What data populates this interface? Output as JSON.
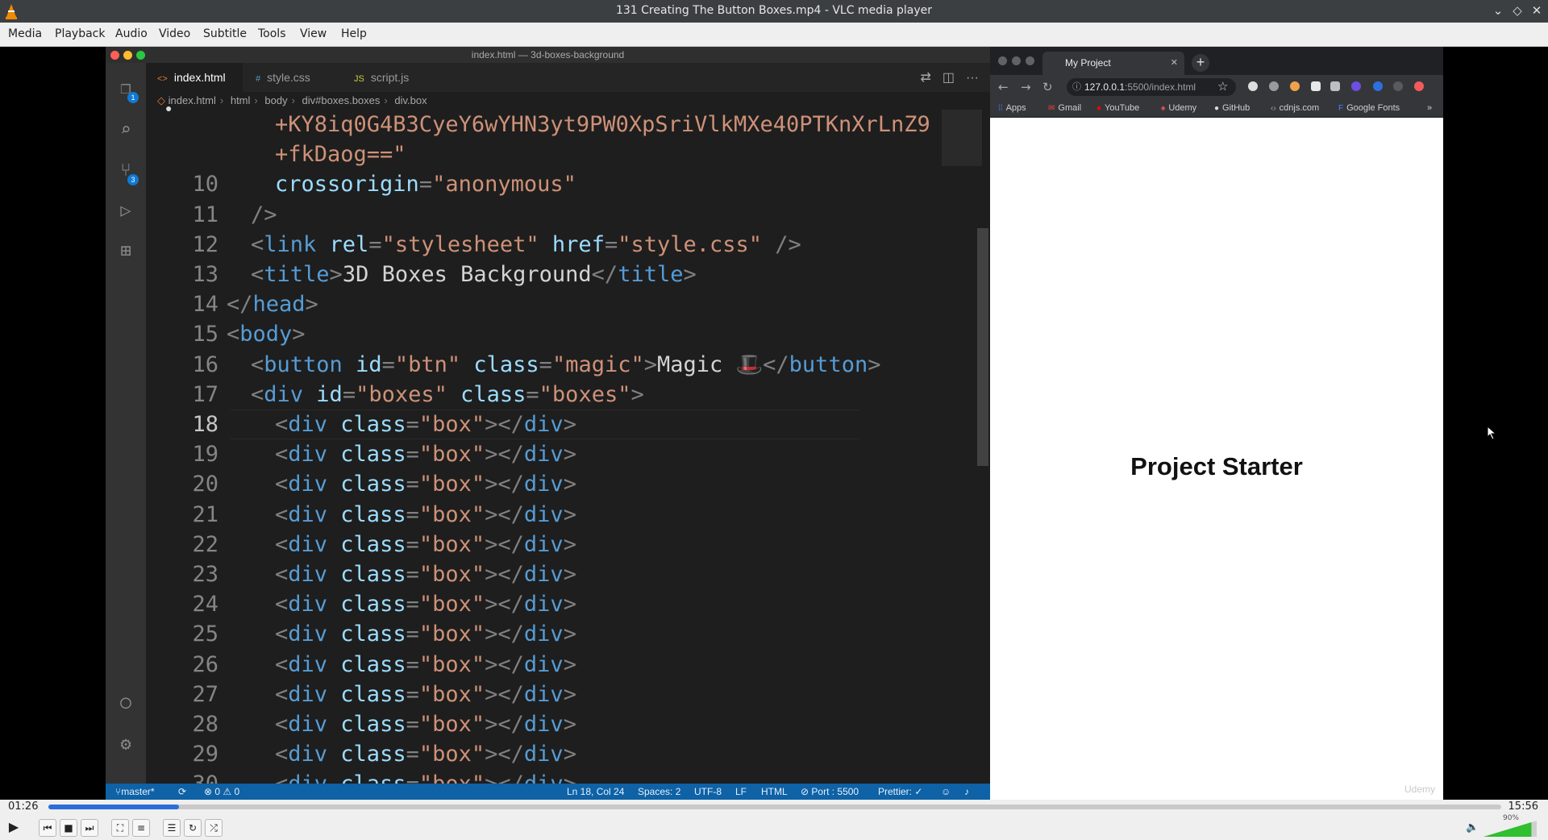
{
  "window": {
    "title": "131 Creating The Button Boxes.mp4 - VLC media player"
  },
  "menubar": [
    "Media",
    "Playback",
    "Audio",
    "Video",
    "Subtitle",
    "Tools",
    "View",
    "Help"
  ],
  "editor": {
    "window_title": "index.html — 3d-boxes-background",
    "tabs": [
      {
        "label": "index.html",
        "icon": "<>",
        "active": true,
        "modified": "●"
      },
      {
        "label": "style.css",
        "icon": "#",
        "active": false
      },
      {
        "label": "script.js",
        "icon": "JS",
        "active": false
      }
    ],
    "breadcrumb": [
      "index.html",
      "html",
      "body",
      "div#boxes.boxes",
      "div.box"
    ],
    "activity_badges": {
      "explorer": "1",
      "source_control": "3"
    },
    "status": {
      "branch": "master*",
      "problems": "⊗ 0 ⚠ 0",
      "position": "Ln 18, Col 24",
      "spaces": "Spaces: 2",
      "encoding": "UTF-8",
      "eol": "LF",
      "language": "HTML",
      "port": "⊘ Port : 5500",
      "prettier": "Prettier: ✓"
    }
  },
  "browser": {
    "tab_title": "My Project",
    "url_host": "127.0.0.1",
    "url_rest": ":5500/index.html",
    "bookmarks": [
      "Apps",
      "Gmail",
      "YouTube",
      "Udemy",
      "GitHub",
      "cdnjs.com",
      "Google Fonts"
    ],
    "more": "»",
    "page_heading": "Project Starter",
    "watermark": "Udemy"
  },
  "player": {
    "elapsed": "01:26",
    "total": "15:56",
    "progress": 0.09,
    "volume_label": "90%",
    "volume": 0.9
  }
}
